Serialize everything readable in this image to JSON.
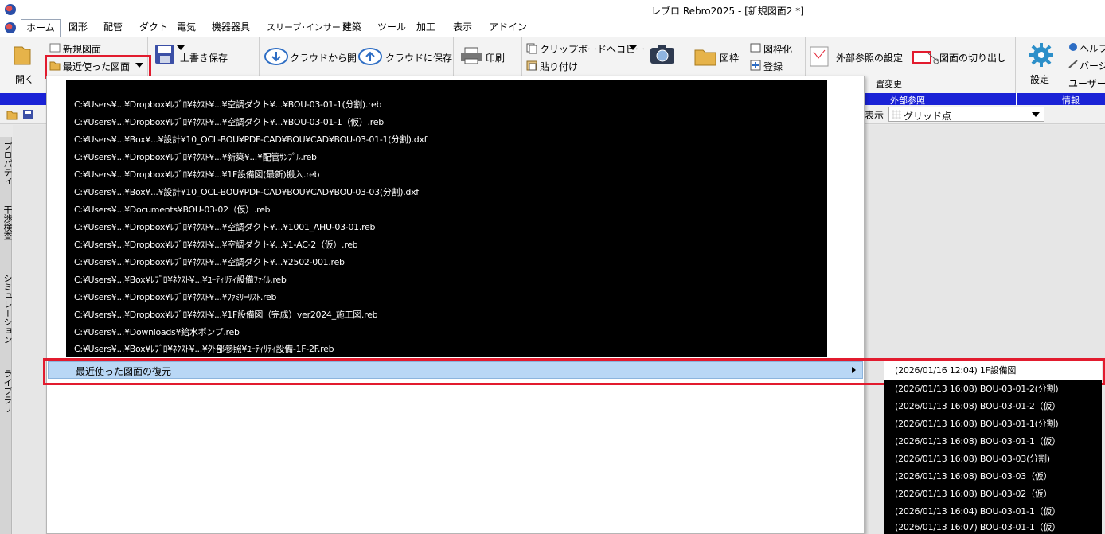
{
  "window": {
    "title": "レブロ Rebro2025 - [新規図面2 *]"
  },
  "menu_tabs": [
    "ホーム",
    "図形",
    "配管",
    "ダクト",
    "電気",
    "機器器具",
    "スリーブ･インサート",
    "建築",
    "ツール",
    "加工",
    "表示",
    "アドイン"
  ],
  "ribbon": {
    "open_label": "開く",
    "new_drawing_label": "新規図面",
    "recent_drawings_label": "最近使った図面",
    "overwrite_save_label": "上書き保存",
    "cloud_open_label": "クラウドから開く",
    "cloud_save_label": "クラウドに保存",
    "print_label": "印刷",
    "copy_clipboard_label": "クリップボードへコピー",
    "paste_label": "貼り付け",
    "frame_label": "図枠",
    "frame_convert_label": "図枠化",
    "register_label": "登録",
    "external_ref_settings_label": "外部参照の設定",
    "cut_drawing_label": "図面の切り出し",
    "change_label": "置変更",
    "settings_label": "設定",
    "help_label": "ヘルプ",
    "version_label": "バージ",
    "user_label": "ユーザー",
    "group_external_ref": "外部参照",
    "group_info": "情報"
  },
  "toolbar": {
    "display_label": "表示",
    "grid_point_label": "グリッド点"
  },
  "side_panel": [
    "プロパティ",
    "干渉検査",
    "シミュレーション",
    "ライブラリ"
  ],
  "recent_files": [
    "C:¥Users¥...¥Dropbox¥ﾚﾌﾞﾛ¥ﾈｸｽﾄ¥...¥空調ダクト¥...¥BOU-03-01-1(分割).reb",
    "C:¥Users¥...¥Dropbox¥ﾚﾌﾞﾛ¥ﾈｸｽﾄ¥...¥空調ダクト¥...¥BOU-03-01-1（仮）.reb",
    "C:¥Users¥...¥Box¥...¥設計¥10_OCL-BOU¥PDF-CAD¥BOU¥CAD¥BOU-03-01-1(分割).dxf",
    "C:¥Users¥...¥Dropbox¥ﾚﾌﾞﾛ¥ﾈｸｽﾄ¥...¥新築¥...¥配管ｻﾝﾌﾟﾙ.reb",
    "C:¥Users¥...¥Dropbox¥ﾚﾌﾞﾛ¥ﾈｸｽﾄ¥...¥1F設備図(最新)搬入.reb",
    "C:¥Users¥...¥Box¥...¥設計¥10_OCL-BOU¥PDF-CAD¥BOU¥CAD¥BOU-03-03(分割).dxf",
    "C:¥Users¥...¥Documents¥BOU-03-02（仮）.reb",
    "C:¥Users¥...¥Dropbox¥ﾚﾌﾞﾛ¥ﾈｸｽﾄ¥...¥空調ダクト¥...¥1001_AHU-03-01.reb",
    "C:¥Users¥...¥Dropbox¥ﾚﾌﾞﾛ¥ﾈｸｽﾄ¥...¥空調ダクト¥...¥1-AC-2（仮）.reb",
    "C:¥Users¥...¥Dropbox¥ﾚﾌﾞﾛ¥ﾈｸｽﾄ¥...¥空調ダクト¥...¥2502-001.reb",
    "C:¥Users¥...¥Box¥ﾚﾌﾞﾛ¥ﾈｸｽﾄ¥...¥ﾕｰﾃｨﾘﾃｨ設備ﾌｧｲﾙ.reb",
    "C:¥Users¥...¥Dropbox¥ﾚﾌﾞﾛ¥ﾈｸｽﾄ¥...¥ﾌｧﾐﾘｰﾘｽﾄ.reb",
    "C:¥Users¥...¥Dropbox¥ﾚﾌﾞﾛ¥ﾈｸｽﾄ¥...¥1F設備図（完成）ver2024_施工図.reb",
    "C:¥Users¥...¥Downloads¥給水ポンプ.reb",
    "C:¥Users¥...¥Box¥ﾚﾌﾞﾛ¥ﾈｸｽﾄ¥...¥外部参照¥ﾕｰﾃｨﾘﾃｨ設備-1F-2F.reb"
  ],
  "restore_label": "最近使った図面の復元",
  "restore_submenu": [
    "(2026/01/16 12:04) 1F設備図",
    "(2026/01/13 16:08) BOU-03-01-2(分割)",
    "(2026/01/13 16:08) BOU-03-01-2（仮）",
    "(2026/01/13 16:08) BOU-03-01-1(分割)",
    "(2026/01/13 16:08) BOU-03-01-1（仮）",
    "(2026/01/13 16:08) BOU-03-03(分割)",
    "(2026/01/13 16:08) BOU-03-03（仮）",
    "(2026/01/13 16:08) BOU-03-02（仮）",
    "(2026/01/13 16:04) BOU-03-01-1（仮）",
    "(2026/01/13 16:07) BOU-03-01-1（仮）"
  ],
  "colors": {
    "accent_red": "#e21b2e",
    "ribbon_blue": "#1a22d6",
    "highlight": "#b9d7f5"
  }
}
